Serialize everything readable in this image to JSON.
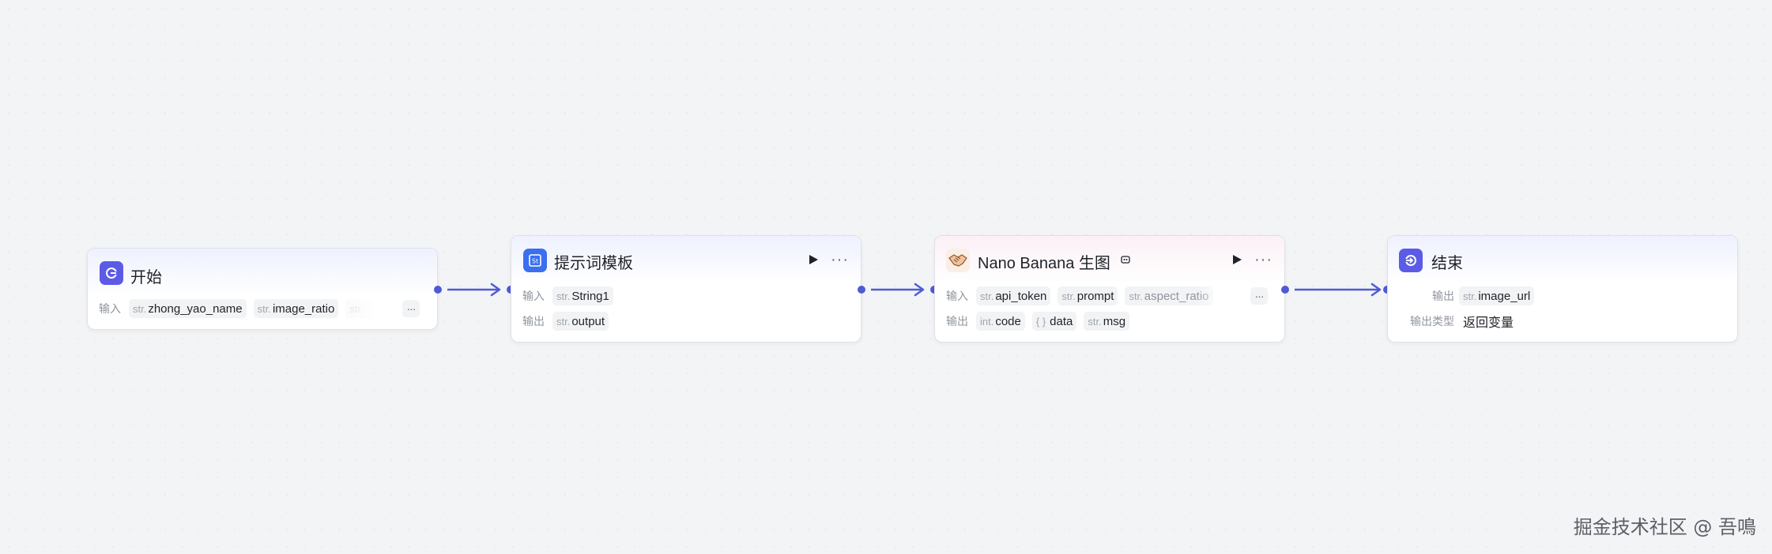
{
  "nodes": {
    "start": {
      "title": "开始",
      "input_label": "输入",
      "inputs": [
        {
          "type": "str.",
          "name": "zhong_yao_name"
        },
        {
          "type": "str.",
          "name": "image_ratio"
        },
        {
          "type": "str.",
          "name": ""
        }
      ],
      "more": "···"
    },
    "prompt_template": {
      "title": "提示词模板",
      "input_label": "输入",
      "output_label": "输出",
      "inputs": [
        {
          "type": "str.",
          "name": "String1"
        }
      ],
      "outputs": [
        {
          "type": "str.",
          "name": "output"
        }
      ],
      "menu": "···"
    },
    "nano_banana": {
      "title": "Nano Banana 生图",
      "input_label": "输入",
      "output_label": "输出",
      "inputs": [
        {
          "type": "str.",
          "name": "api_token"
        },
        {
          "type": "str.",
          "name": "prompt"
        },
        {
          "type": "str.",
          "name": "aspect_ratio"
        }
      ],
      "outputs": [
        {
          "type": "int.",
          "name": "code"
        },
        {
          "type": "{ }",
          "name": "data"
        },
        {
          "type": "str.",
          "name": "msg"
        }
      ],
      "more": "···",
      "menu": "···"
    },
    "end": {
      "title": "结束",
      "output_label": "输出",
      "output_type_label": "输出类型",
      "outputs": [
        {
          "type": "str.",
          "name": "image_url"
        }
      ],
      "output_type_value": "返回变量"
    }
  },
  "colors": {
    "accent": "#5b5be6",
    "edge": "#4e5bd6",
    "canvas": "#f3f4f6"
  },
  "icons": {
    "start": "start-power-icon",
    "prompt_template": "template-icon",
    "nano_banana": "handshake-icon",
    "nano_banana_badge": "robot-badge-icon",
    "end": "end-exit-icon"
  },
  "watermark": "掘金技术社区 @ 吾鳴"
}
